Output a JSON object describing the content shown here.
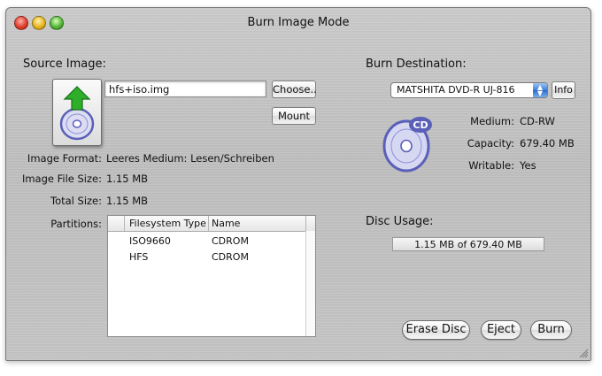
{
  "window": {
    "title": "Burn Image Mode"
  },
  "source": {
    "heading": "Source Image:",
    "file_name": "hfs+iso.img",
    "choose_label": "Choose..",
    "mount_label": "Mount",
    "format_label": "Image Format:",
    "format_value": "Leeres Medium: Lesen/Schreiben",
    "file_size_label": "Image File Size:",
    "file_size_value": "1.15 MB",
    "total_size_label": "Total Size:",
    "total_size_value": "1.15 MB",
    "partitions_label": "Partitions:"
  },
  "partitions": {
    "columns": [
      "Filesystem Type",
      "Name"
    ],
    "rows": [
      {
        "fs": "ISO9660",
        "name": "CDROM"
      },
      {
        "fs": "HFS",
        "name": "CDROM"
      }
    ]
  },
  "destination": {
    "heading": "Burn Destination:",
    "drive": "MATSHITA DVD-R UJ-816",
    "info_label": "Info",
    "medium_label": "Medium:",
    "medium_value": "CD-RW",
    "capacity_label": "Capacity:",
    "capacity_value": "679.40 MB",
    "writable_label": "Writable:",
    "writable_value": "Yes",
    "disc_badge": "CD"
  },
  "usage": {
    "heading": "Disc Usage:",
    "text": "1.15 MB of 679.40 MB"
  },
  "buttons": {
    "erase": "Erase Disc",
    "eject": "Eject",
    "burn": "Burn"
  },
  "colors": {
    "accent_blue": "#3c7fd9",
    "arrow_green": "#2fae2a",
    "disc_purple": "#5a5fb8"
  }
}
